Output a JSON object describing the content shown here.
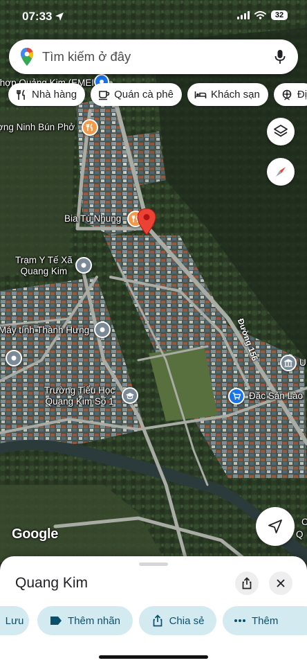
{
  "status_bar": {
    "time": "07:33",
    "battery": "32"
  },
  "search": {
    "placeholder": "Tìm kiếm ở đây"
  },
  "chips": [
    {
      "label": "Nhà hàng",
      "icon": "fork-knife-icon"
    },
    {
      "label": "Quán cà phê",
      "icon": "coffee-cup-icon"
    },
    {
      "label": "Khách sạn",
      "icon": "bed-icon"
    },
    {
      "label": "Đị",
      "icon": "attraction-icon"
    }
  ],
  "map": {
    "labels": {
      "top_partial": "thợp Quảng Kim (EMEI",
      "bun_pho": "ợng Ninh Bún Phở",
      "bia": "Bia Tú Nhung",
      "tram_y_te_1": "Trạm Y Tế Xã",
      "tram_y_te_2": "Quang Kim",
      "may_tinh": "Máy tính Thành Hưng",
      "truong_1": "Trường Tiểu Học",
      "truong_2": "Quang Kim Số 1",
      "road": "Đường 156",
      "dac_san": "Đặc Sản Lào",
      "right_u": "U",
      "right_c": "C",
      "right_q": "Q"
    },
    "google_logo": "Google",
    "colors": {
      "pin_red": "#ea4335",
      "food_orange": "#f2994a",
      "gov_gray": "#7b8a97",
      "shop_blue": "#1a73e8"
    }
  },
  "sheet": {
    "title": "Quang Kim",
    "actions": [
      {
        "label": "Lưu",
        "icon": "bookmark-icon"
      },
      {
        "label": "Thêm nhãn",
        "icon": "label-icon"
      },
      {
        "label": "Chia sẻ",
        "icon": "share-icon"
      },
      {
        "label": "Thêm",
        "icon": "more-icon"
      }
    ]
  }
}
